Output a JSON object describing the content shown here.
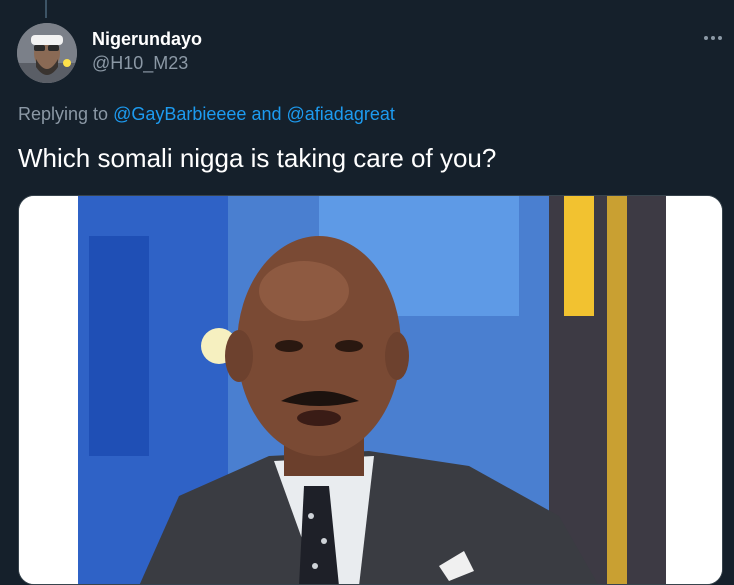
{
  "tweet": {
    "author_name": "Nigerundayo",
    "author_handle": "@H10_M23",
    "replying_prefix": "Replying to",
    "reply_user_1": "@GayBarbieeee",
    "reply_and": "and",
    "reply_user_2": "@afiadagreat",
    "text": "Which somali nigga is taking care of you?"
  },
  "icons": {
    "more": "more-horizontal-icon"
  },
  "colors": {
    "background": "#15202b",
    "primary_text": "#ffffff",
    "secondary_text": "#8b98a5",
    "link": "#1d9bf0"
  },
  "media": {
    "type": "video-still",
    "description_hidden": true
  }
}
